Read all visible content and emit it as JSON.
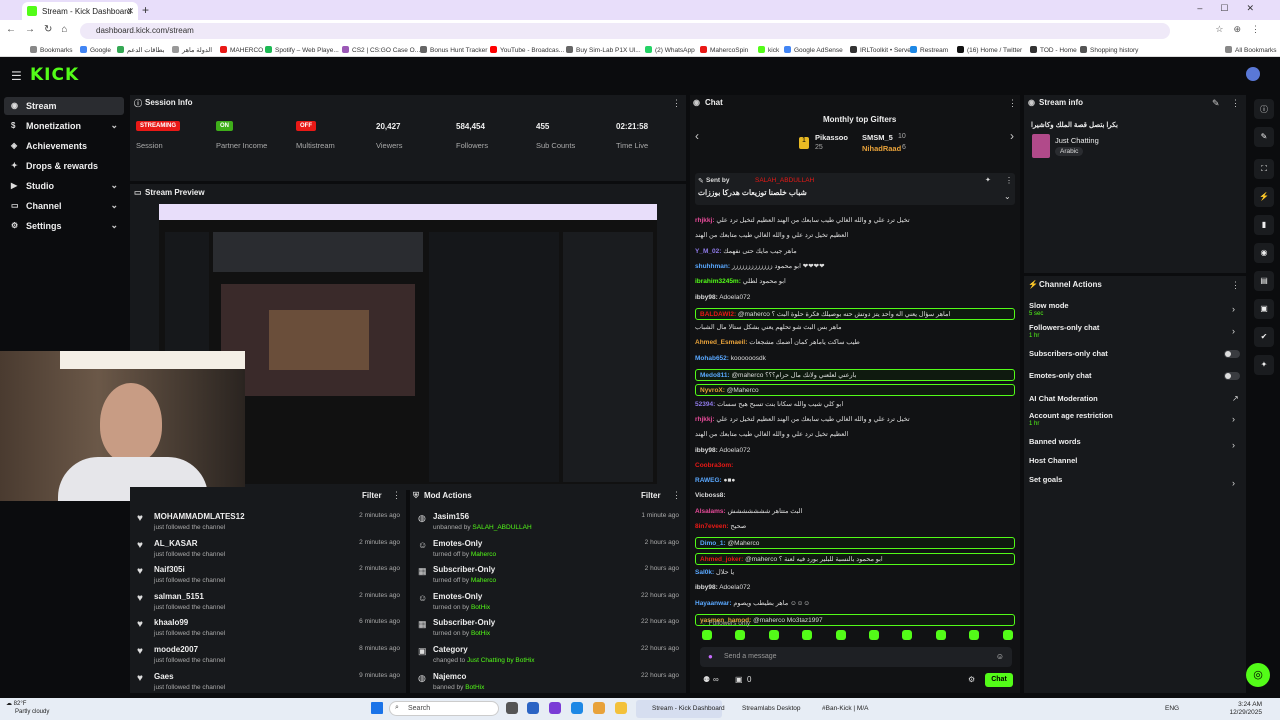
{
  "browser": {
    "tab_title": "Stream - Kick Dashboard",
    "url": "dashboard.kick.com/stream",
    "bookmarks": [
      "Bookmarks",
      "Google",
      "بطاقات الدعم",
      "الدولة ماهر",
      "MAHERCO",
      "Spotify – Web Playe...",
      "CS2 | CS:GO Case O...",
      "Bonus Hunt Tracker",
      "YouTube - Broadcas...",
      "Buy Sim-Lab P1X Ul...",
      "(2) WhatsApp",
      "MahercoSpin",
      "kick",
      "Google AdSense",
      "IRLToolkit • Server",
      "Restream",
      "(16) Home / Twitter",
      "TOD - Home",
      "Shopping history",
      "All Bookmarks"
    ]
  },
  "app": {
    "logo": "KICK"
  },
  "sidebar": {
    "items": [
      {
        "label": "Stream",
        "active": true
      },
      {
        "label": "Monetization"
      },
      {
        "label": "Achievements"
      },
      {
        "label": "Drops & rewards"
      },
      {
        "label": "Studio"
      },
      {
        "label": "Channel"
      },
      {
        "label": "Settings"
      }
    ]
  },
  "session": {
    "title": "Session Info",
    "stats": [
      {
        "value": "STREAMING",
        "label": "Session",
        "pill": "#e91916"
      },
      {
        "value": "ON",
        "label": "Partner Income",
        "pill": "#3fae1a"
      },
      {
        "value": "OFF",
        "label": "Multistream",
        "pill": "#e91916"
      },
      {
        "value": "20,427",
        "label": "Viewers"
      },
      {
        "value": "584,454",
        "label": "Followers"
      },
      {
        "value": "455",
        "label": "Sub Counts"
      },
      {
        "value": "02:21:58",
        "label": "Time Live"
      }
    ]
  },
  "preview": {
    "title": "Stream Preview"
  },
  "followers": {
    "filter": "Filter",
    "items": [
      {
        "name": "MOHAMMADMLATES12",
        "action": "just followed the channel",
        "time": "2 minutes ago"
      },
      {
        "name": "AL_KASAR",
        "action": "just followed the channel",
        "time": "2 minutes ago"
      },
      {
        "name": "Naif305i",
        "action": "just followed the channel",
        "time": "2 minutes ago"
      },
      {
        "name": "salman_5151",
        "action": "just followed the channel",
        "time": "2 minutes ago"
      },
      {
        "name": "khaalo99",
        "action": "just followed the channel",
        "time": "6 minutes ago"
      },
      {
        "name": "moode2007",
        "action": "just followed the channel",
        "time": "8 minutes ago"
      },
      {
        "name": "Gaes",
        "action": "just followed the channel",
        "time": "9 minutes ago"
      }
    ]
  },
  "mod_actions": {
    "title": "Mod Actions",
    "filter": "Filter",
    "items": [
      {
        "name": "Jasim156",
        "action": "unbanned by",
        "by": "SALAH_ABDULLAH",
        "time": "1 minute ago"
      },
      {
        "name": "Emotes-Only",
        "action": "turned off by",
        "by": "Maherco",
        "time": "2 hours ago"
      },
      {
        "name": "Subscriber-Only",
        "action": "turned off by",
        "by": "Maherco",
        "time": "2 hours ago"
      },
      {
        "name": "Emotes-Only",
        "action": "turned on by",
        "by": "BotHix",
        "time": "22 hours ago"
      },
      {
        "name": "Subscriber-Only",
        "action": "turned on by",
        "by": "BotHix",
        "time": "22 hours ago"
      },
      {
        "name": "Category",
        "action": "changed to",
        "by": "Just Chatting by BotHix",
        "time": "22 hours ago"
      },
      {
        "name": "Najemco",
        "action": "banned by",
        "by": "BotHix",
        "time": "22 hours ago"
      }
    ]
  },
  "chat": {
    "title": "Chat",
    "gifters_title": "Monthly top Gifters",
    "gifters": [
      {
        "name": "Pikassoo",
        "count": "25"
      },
      {
        "name": "SMSM_5",
        "count": "10"
      },
      {
        "name": "NihadRaad",
        "count": "6"
      }
    ],
    "pinned_by": "Sent by",
    "pinned_user": "SALAH_ABDULLAH",
    "pinned_text": "شباب خلصنا توزيعات هدركا بوززات",
    "messages": [
      {
        "user": "rhjkkj:",
        "text": "تخيل ترد علي و والله الغالي طيب سابعك من الهند العظيم لتخيل ترد علي",
        "color": "#e84b9a"
      },
      {
        "user": "",
        "text": "العظيم تخيل ترد علي و والله الغالي طيب متابعك من الهند",
        "color": "#ddd"
      },
      {
        "user": "Y_M_02:",
        "text": "ماهر جيب مايك حتى نفهمك",
        "color": "#8f7ae8"
      },
      {
        "user": "shuhhman:",
        "text": "ابو محمود ززززززززززززز ❤❤❤❤",
        "color": "#5aa8ff"
      },
      {
        "user": "ibrahim3245m:",
        "text": "ابو محمود لطلي",
        "color": "#53fc18"
      },
      {
        "user": "ibby98:",
        "text": "Adoela072",
        "color": "#ddd"
      },
      {
        "user": "BALDAWI2:",
        "text": "@maherco اماهر سؤال يعني اله واحد يتز دوتش حته بوصيلك فكرة حلوة البث ؟",
        "color": "#e91916",
        "hl": true
      },
      {
        "user": "",
        "text": "ماهر بس البث شو تحلهم يعني بشكل ستالا مال الشباب",
        "color": "#ddd"
      },
      {
        "user": "Ahmed_Esmaeil:",
        "text": "طيب ساكت ياماهر كمان أضمك مشجعات",
        "color": "#e8a23a"
      },
      {
        "user": "Mohab652:",
        "text": "koooooosdk",
        "color": "#5aa8ff"
      },
      {
        "user": "Medo811:",
        "text": "@maherco بارعني لعلعني ولانك مال حرام؟؟؟",
        "color": "#5aa8ff",
        "hl": true
      },
      {
        "user": "NyvroX:",
        "text": "@Maherco",
        "color": "#e8a23a",
        "hl": true
      },
      {
        "user": "52394:",
        "text": "ابو كلي شيب والله سكانا بنت تسبح هيح سسات",
        "color": "#8f7ae8"
      },
      {
        "user": "rhjkkj:",
        "text": "تخيل ترد علي و والله الغالي طيب سابعك من الهند العظيم لتخيل ترد علي",
        "color": "#e84b9a"
      },
      {
        "user": "",
        "text": "العظيم تخيل ترد علي و والله الغالي طيب متابعك من الهند",
        "color": "#ddd"
      },
      {
        "user": "ibby98:",
        "text": "Adoela072",
        "color": "#ddd"
      },
      {
        "user": "Coobra3om:",
        "text": "",
        "color": "#e91916"
      },
      {
        "user": "RAWEG:",
        "text": "●■●",
        "color": "#5aa8ff"
      },
      {
        "user": "Vicboss8:",
        "text": "",
        "color": "#ddd"
      },
      {
        "user": "Alsalams:",
        "text": "البث متتاهر ششششششش",
        "color": "#e84b9a"
      },
      {
        "user": "8in7eveen:",
        "text": "صحيح",
        "color": "#e91916"
      },
      {
        "user": "Dimo_1:",
        "text": "@Maherco",
        "color": "#5aa8ff",
        "hl": true
      },
      {
        "user": "Ahmed_joker:",
        "text": "@maherco ابو محمود بالنسبة للبلير بورد فيه لعنة ؟",
        "color": "#e91916",
        "hl": true
      },
      {
        "user": "Sal0k:",
        "text": "يا حلال",
        "color": "#5aa8ff"
      },
      {
        "user": "ibby98:",
        "text": "Adoela072",
        "color": "#ddd"
      },
      {
        "user": "Hayaanwar:",
        "text": "ماهر بطيطب ويصوم ☺☺☺",
        "color": "#5aa8ff"
      },
      {
        "user": "yasmen_hamod:",
        "text": "@maherco Mo3taz1997",
        "color": "#e8a23a",
        "hl": true
      }
    ],
    "followers_only": "Followers only",
    "placeholder": "Send a message",
    "viewers_count": "∞",
    "bag_count": "0",
    "send_label": "Chat"
  },
  "stream_info": {
    "title": "Stream info",
    "stream_title": "بكرا بتصل قصة الملك وكاشيرا",
    "category": "Just Chatting",
    "tag": "Arabic"
  },
  "channel_actions": {
    "title": "Channel Actions",
    "items": [
      {
        "label": "Slow mode",
        "sub": "5 sec",
        "ctl": "arrow"
      },
      {
        "label": "Followers-only chat",
        "sub": "1 hr",
        "ctl": "arrow"
      },
      {
        "label": "Subscribers-only chat",
        "ctl": "toggle"
      },
      {
        "label": "Emotes-only chat",
        "ctl": "toggle"
      },
      {
        "label": "AI Chat Moderation",
        "ctl": "link"
      },
      {
        "label": "Account age restriction",
        "sub": "1 hr",
        "ctl": "arrow"
      },
      {
        "label": "Banned words",
        "ctl": "arrow"
      },
      {
        "label": "Host Channel",
        "ctl": ""
      },
      {
        "label": "Set goals",
        "ctl": "arrow"
      }
    ]
  },
  "taskbar": {
    "weather_temp": "82°F",
    "weather_desc": "Partly cloudy",
    "search": "Search",
    "apps": [
      "Stream - Kick Dashboard",
      "Streamlabs Desktop",
      "#Ban-Kick | M/A"
    ],
    "lang": "ENG",
    "time": "3:24 AM",
    "date": "12/29/2025"
  },
  "colors": {
    "accent": "#53fc18",
    "live": "#e91916"
  }
}
